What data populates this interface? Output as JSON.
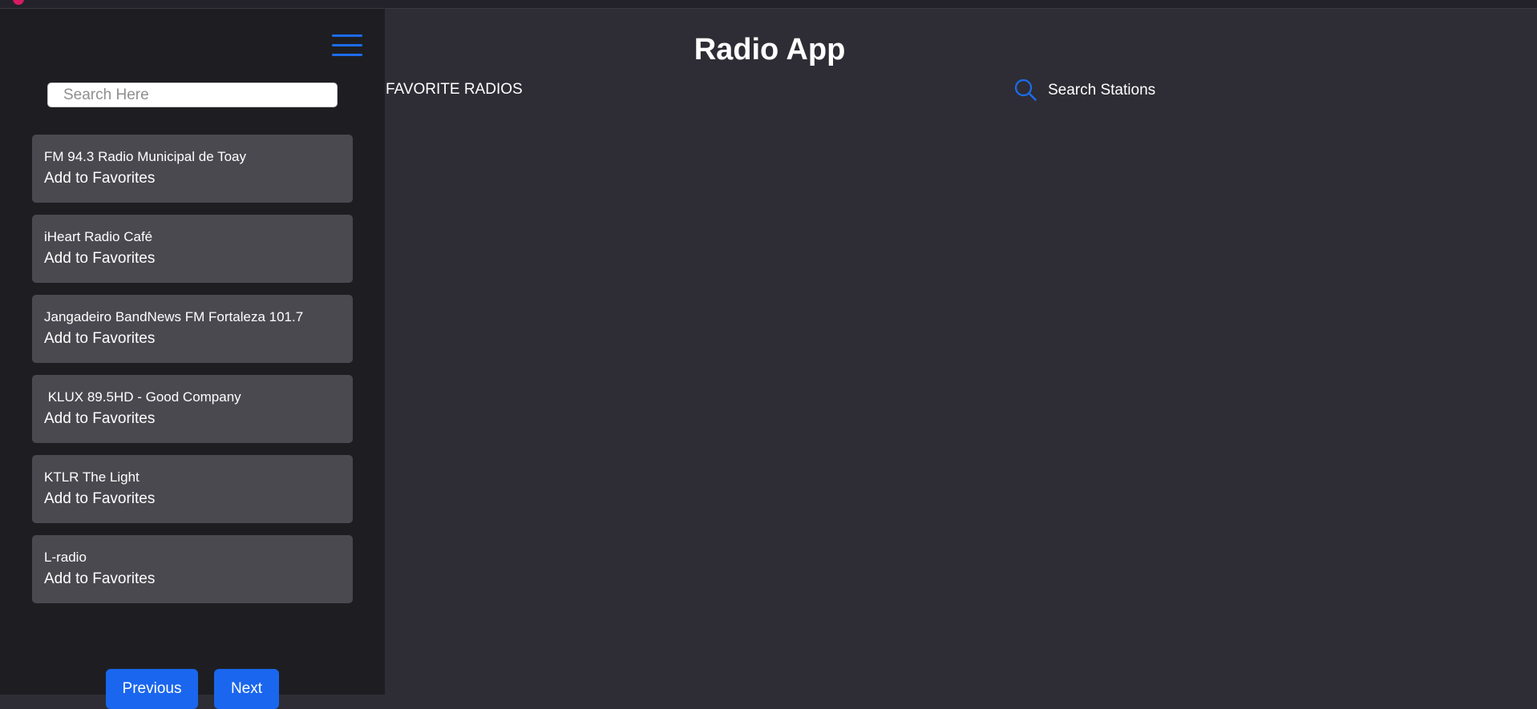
{
  "app": {
    "title": "Radio App"
  },
  "sidebar": {
    "search_placeholder": "Search Here",
    "stations": [
      {
        "name": "FM 94.3 Radio Municipal de Toay",
        "action": "Add to Favorites"
      },
      {
        "name": "iHeart Radio Café",
        "action": "Add to Favorites"
      },
      {
        "name": "Jangadeiro BandNews FM Fortaleza 101.7",
        "action": "Add to Favorites"
      },
      {
        "name": " KLUX 89.5HD - Good Company",
        "action": "Add to Favorites"
      },
      {
        "name": "KTLR The Light",
        "action": "Add to Favorites"
      },
      {
        "name": "L-radio",
        "action": "Add to Favorites"
      }
    ],
    "pagination": {
      "previous_label": "Previous",
      "next_label": "Next"
    }
  },
  "nav": {
    "favorites_label": "FAVORITE RADIOS",
    "search_label": "Search Stations"
  },
  "colors": {
    "accent": "#1c6cf0",
    "background": "#2e2d35",
    "sidebar": "#1e1e22",
    "card": "#4a4950"
  },
  "icons": {
    "menu": "hamburger-icon",
    "search": "search-icon"
  }
}
